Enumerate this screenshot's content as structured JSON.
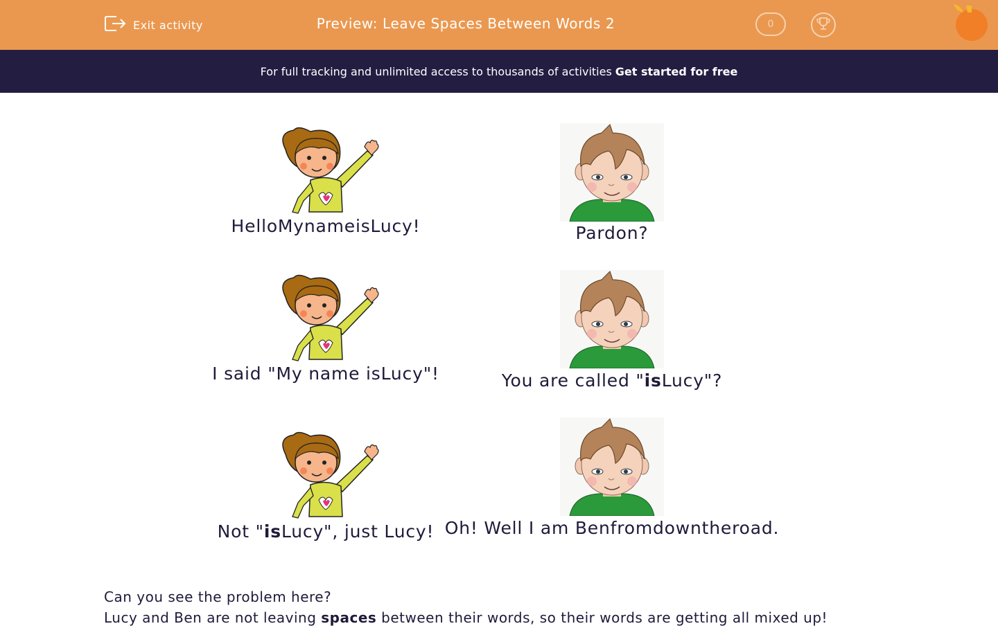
{
  "header": {
    "exit_label": "Exit activity",
    "title": "Preview: Leave Spaces Between Words 2",
    "score": "0",
    "accent_color": "#ea9850",
    "icons": [
      "exit-icon",
      "trophy-icon",
      "logo-icon"
    ]
  },
  "promo": {
    "text": "For full tracking and unlimited access to thousands of activities",
    "cta": "Get started for free",
    "background": "#241d42"
  },
  "dialogue": [
    {
      "lucy": {
        "pre": "HelloMynameisLucy!",
        "bold": "",
        "post": ""
      },
      "ben": {
        "pre": "Pardon?",
        "bold": "",
        "post": ""
      }
    },
    {
      "lucy": {
        "pre": "I said \"My name isLucy\"!",
        "bold": "",
        "post": ""
      },
      "ben": {
        "pre": "You are called \"",
        "bold": "is",
        "post": "Lucy\"?"
      }
    },
    {
      "lucy": {
        "pre": "Not \"",
        "bold": "is",
        "post": "Lucy\", just Lucy!"
      },
      "ben": {
        "pre": "Oh! Well I am Benfromdowntheroad.",
        "bold": "",
        "post": ""
      }
    }
  ],
  "explanation": {
    "line1": "Can you see the problem here?",
    "line2_pre": "Lucy and Ben are not leaving ",
    "line2_bold": "spaces",
    "line2_post": " between their words, so their words are getting all mixed up!"
  }
}
